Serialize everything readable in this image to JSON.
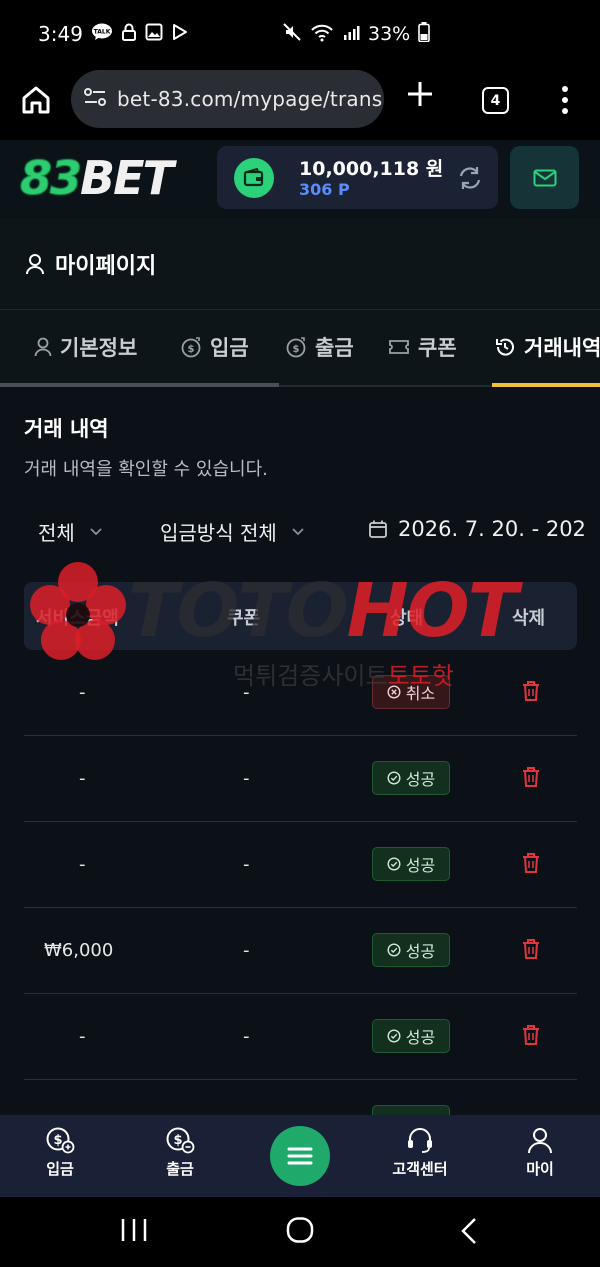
{
  "status_bar": {
    "time": "3:49",
    "talk": "TALK",
    "battery": "33%"
  },
  "browser": {
    "url": "bet-83.com/mypage/trans",
    "tab_count": "4"
  },
  "site": {
    "logo_num": "83",
    "logo_text": "BET",
    "balance": "10,000,118 원",
    "points": "306 P",
    "colors": {
      "accent_green": "#2bd27a",
      "tab_underline": "#f2c13a",
      "points_blue": "#5b8cff"
    }
  },
  "mypage": {
    "title": "마이페이지"
  },
  "tabs": [
    {
      "label": "기본정보"
    },
    {
      "label": "입금"
    },
    {
      "label": "출금"
    },
    {
      "label": "쿠폰"
    },
    {
      "label": "거래내역"
    }
  ],
  "section": {
    "title": "거래 내역",
    "subtitle": "거래 내역을 확인할 수 있습니다."
  },
  "filters": {
    "type": "전체",
    "method": "입금방식 전체",
    "date": "2026. 7. 20. - 202"
  },
  "table": {
    "headers": [
      "서비스금액",
      "쿠폰",
      "상태",
      "삭제"
    ],
    "rows": [
      {
        "amount": "-",
        "coupon": "-",
        "status": "취소",
        "status_type": "cancel"
      },
      {
        "amount": "-",
        "coupon": "-",
        "status": "성공",
        "status_type": "success"
      },
      {
        "amount": "-",
        "coupon": "-",
        "status": "성공",
        "status_type": "success"
      },
      {
        "amount": "₩6,000",
        "coupon": "-",
        "status": "성공",
        "status_type": "success"
      },
      {
        "amount": "-",
        "coupon": "-",
        "status": "성공",
        "status_type": "success"
      }
    ]
  },
  "watermark": {
    "logo_a": "TOTO",
    "logo_b": "HOT",
    "sub_a": "먹튀검증사이트",
    "sub_b": "토토핫"
  },
  "bottom_nav": [
    {
      "label": "입금",
      "icon": "dollar-plus-icon"
    },
    {
      "label": "출금",
      "icon": "dollar-minus-icon"
    },
    {
      "label": "",
      "icon": "menu-icon"
    },
    {
      "label": "고객센터",
      "icon": "headset-icon"
    },
    {
      "label": "마이",
      "icon": "user-icon"
    }
  ]
}
